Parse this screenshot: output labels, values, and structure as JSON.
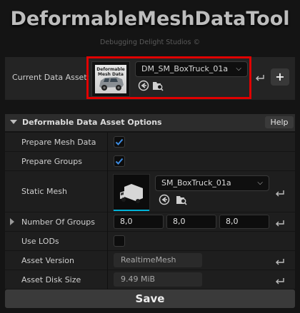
{
  "window": {
    "title": "DeformableMeshDataTool",
    "studio": "Debugging Delight Studios ©"
  },
  "current_asset": {
    "label": "Current Data Asset:",
    "thumbnail_text": "Deformable Mesh Data",
    "selected": "DM_SM_BoxTruck_01a",
    "add_label": "+"
  },
  "options": {
    "header": "Deformable Data Asset Options",
    "help_label": "Help",
    "prepare_mesh_data": {
      "label": "Prepare Mesh Data",
      "checked": true
    },
    "prepare_groups": {
      "label": "Prepare Groups",
      "checked": true
    },
    "static_mesh": {
      "label": "Static Mesh",
      "selected": "SM_BoxTruck_01a"
    },
    "number_of_groups": {
      "label": "Number Of Groups",
      "values": [
        "8,0",
        "8,0",
        "8,0"
      ]
    },
    "use_lods": {
      "label": "Use LODs",
      "checked": false
    },
    "asset_version": {
      "label": "Asset Version",
      "value": "RealtimeMesh"
    },
    "asset_disk_size": {
      "label": "Asset Disk Size",
      "value": "9.49 MiB"
    }
  },
  "footer": {
    "save_label": "Save"
  },
  "colors": {
    "highlight_border": "#e00000",
    "check": "#3d8be0",
    "accent": "#00b4d8"
  }
}
